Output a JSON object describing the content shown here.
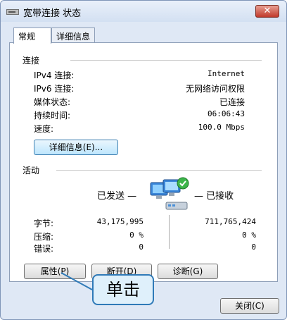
{
  "window": {
    "title": "宽带连接 状态",
    "close_label": "✕"
  },
  "tabs": [
    {
      "label": "常规"
    },
    {
      "label": "详细信息"
    }
  ],
  "connection": {
    "section_label": "连接",
    "rows": [
      {
        "label": "IPv4 连接:",
        "value": "Internet"
      },
      {
        "label": "IPv6 连接:",
        "value": "无网络访问权限"
      },
      {
        "label": "媒体状态:",
        "value": "已连接"
      },
      {
        "label": "持续时间:",
        "value": "06:06:43"
      },
      {
        "label": "速度:",
        "value": "100.0 Mbps"
      }
    ],
    "details_button": "详细信息(E)..."
  },
  "activity": {
    "section_label": "活动",
    "sent_label": "已发送 —",
    "received_label": "— 已接收",
    "stats": [
      {
        "label": "字节:",
        "sent": "43,175,995",
        "received": "711,765,424"
      },
      {
        "label": "压缩:",
        "sent": "0 %",
        "received": "0 %"
      },
      {
        "label": "错误:",
        "sent": "0",
        "received": "0"
      }
    ]
  },
  "buttons": {
    "properties": "属性(P)",
    "disable": "断开(D)",
    "diagnose": "诊断(G)",
    "close": "关闭(C)"
  },
  "callout": {
    "text": "单击"
  },
  "colors": {
    "accent": "#2f7ab8",
    "callout_fill": "#dff0fb",
    "close_button": "#c0392b"
  }
}
